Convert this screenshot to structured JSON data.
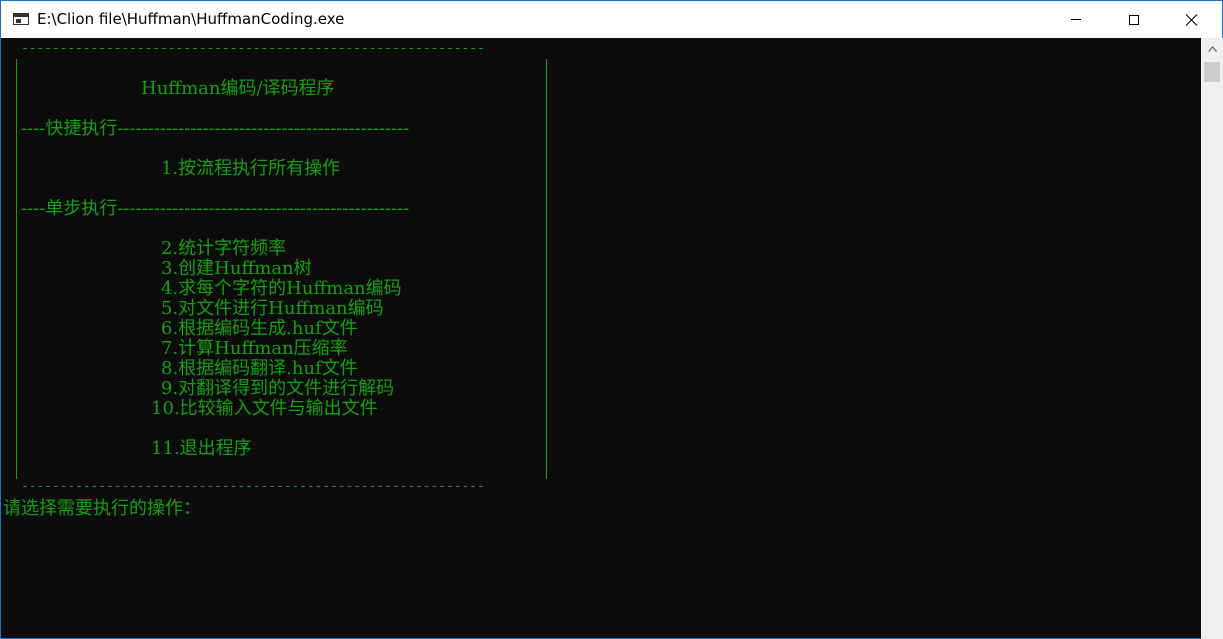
{
  "window": {
    "title": "E:\\Clion file\\Huffman\\HuffmanCoding.exe"
  },
  "menu": {
    "top_rule": "------------------------------------------------------------",
    "title": "Huffman编码/译码程序",
    "section_quick": "----快捷执行------------------------------------------------",
    "item_1": "1.按流程执行所有操作",
    "section_step": "----单步执行------------------------------------------------",
    "items": [
      "2.统计字符频率",
      "3.创建Huffman树",
      "4.求每个字符的Huffman编码",
      "5.对文件进行Huffman编码",
      "6.根据编码生成.huf文件",
      "7.计算Huffman压缩率",
      "8.根据编码翻译.huf文件",
      "9.对翻译得到的文件进行解码",
      "10.比较输入文件与输出文件"
    ],
    "item_exit": "11.退出程序",
    "bottom_rule": "------------------------------------------------------------"
  },
  "prompt": "请选择需要执行的操作：",
  "colors": {
    "console_bg": "#0c0c0c",
    "console_text": "#13a10e",
    "titlebar_bg": "#ffffff",
    "window_border": "#1a73c9"
  },
  "icons": {
    "app": "console-window-icon",
    "minimize": "minimize-icon",
    "maximize": "maximize-icon",
    "close": "close-icon",
    "scroll_up": "scroll-up-arrow-icon"
  }
}
